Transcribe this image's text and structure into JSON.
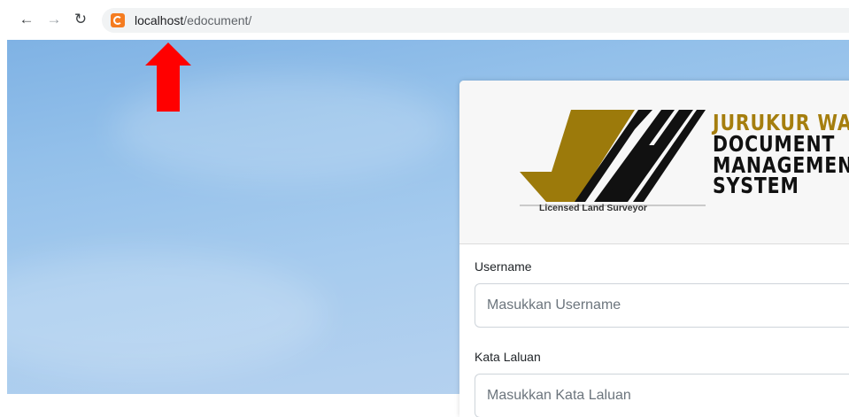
{
  "browser": {
    "url_host": "localhost",
    "url_path": "/edocument/",
    "back_icon": "arrow-left-icon",
    "forward_icon": "arrow-right-icon",
    "reload_icon": "reload-icon",
    "site_icon": "xampp-icon"
  },
  "logo": {
    "caption": "Licensed Land Surveyor",
    "colors": {
      "gold": "#9c7a0b",
      "black": "#111111"
    }
  },
  "brand": {
    "line1": "JURUKUR WATA",
    "line2": "DOCUMENT",
    "line3": "MANAGEMENT",
    "line4": "SYSTEM",
    "accent": "#a57e0e"
  },
  "form": {
    "username_label": "Username",
    "username_placeholder": "Masukkan Username",
    "password_label": "Kata Laluan",
    "password_placeholder": "Masukkan Kata Laluan"
  },
  "annotation": {
    "color": "#ff0000",
    "icon": "red-up-arrow-icon"
  }
}
